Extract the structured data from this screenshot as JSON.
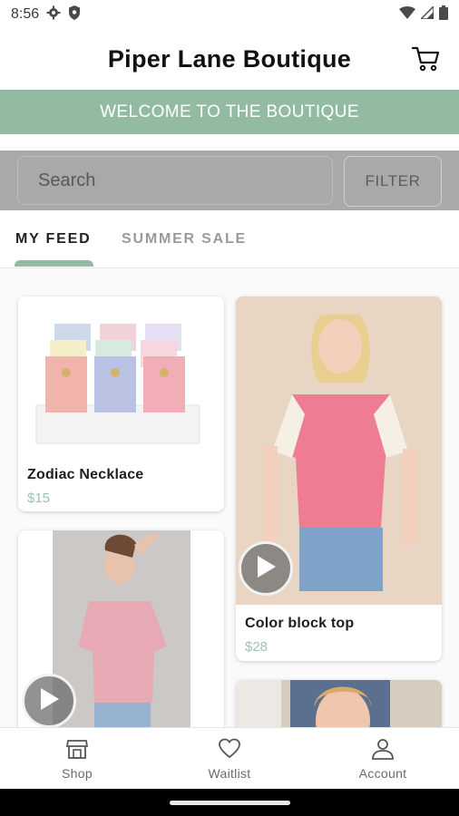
{
  "status": {
    "time": "8:56"
  },
  "header": {
    "title": "Piper Lane Boutique"
  },
  "banner": {
    "text": "WELCOME TO THE BOUTIQUE"
  },
  "search": {
    "placeholder": "Search",
    "filter_label": "FILTER"
  },
  "tabs": [
    {
      "label": "MY FEED"
    },
    {
      "label": "SUMMER SALE"
    }
  ],
  "feed": {
    "products": [
      {
        "name": "Zodiac Necklace",
        "price": "$15"
      },
      {
        "name": "Color block top",
        "price": "$28"
      }
    ]
  },
  "nav": [
    {
      "label": "Shop",
      "icon": "shop-icon"
    },
    {
      "label": "Waitlist",
      "icon": "heart-icon"
    },
    {
      "label": "Account",
      "icon": "account-icon"
    }
  ],
  "colors": {
    "accent": "#93bba2",
    "price": "#9fc2ad",
    "search_band": "#a9a9a9"
  }
}
